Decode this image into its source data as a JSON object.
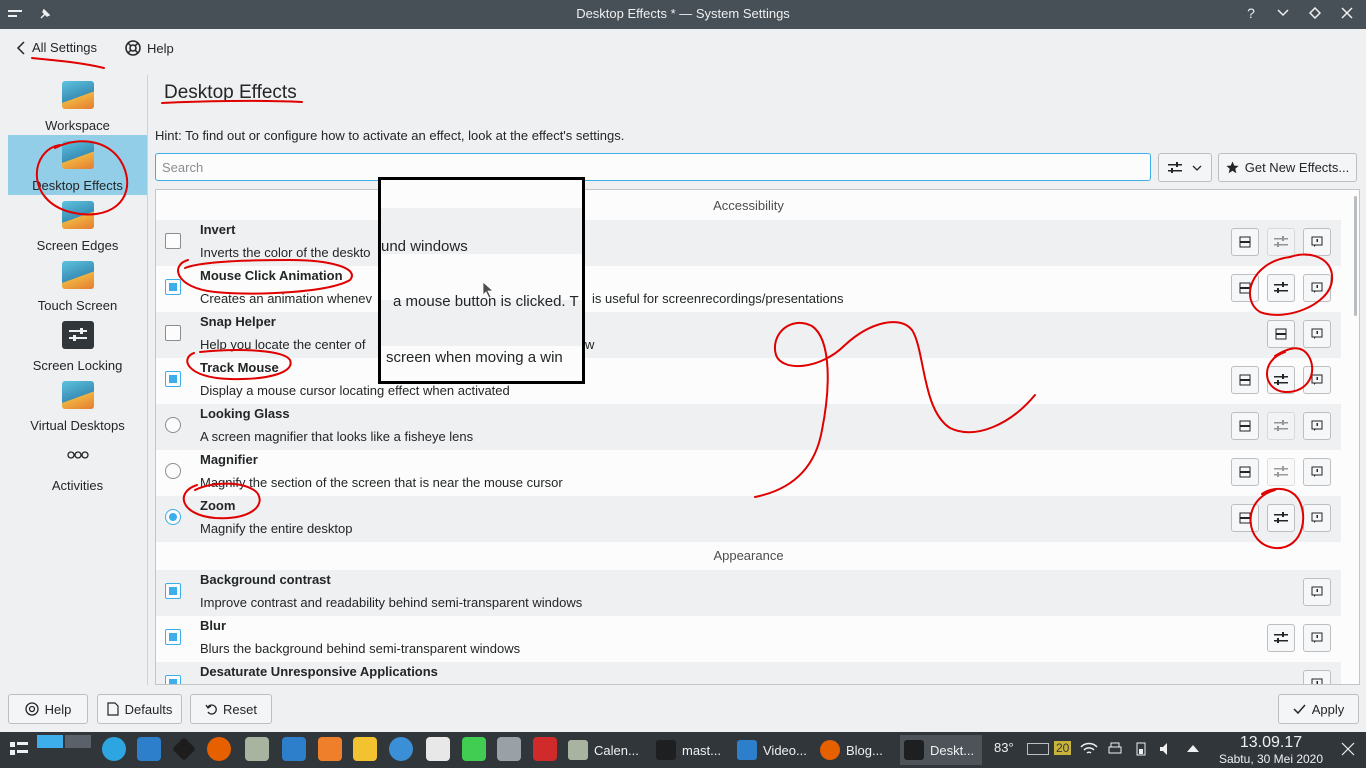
{
  "window": {
    "title": "Desktop Effects * — System Settings",
    "controls": [
      "?",
      "⌄",
      "◇",
      "✕"
    ]
  },
  "toolbar": {
    "back_label": "All Settings",
    "help_label": "Help"
  },
  "sidebar": {
    "items": [
      {
        "label": "Workspace"
      },
      {
        "label": "Desktop Effects"
      },
      {
        "label": "Screen Edges"
      },
      {
        "label": "Touch Screen"
      },
      {
        "label": "Screen Locking"
      },
      {
        "label": "Virtual Desktops"
      },
      {
        "label": "Activities"
      }
    ]
  },
  "main": {
    "title": "Desktop Effects",
    "hint": "Hint: To find out or configure how to activate an effect, look at the effect's settings.",
    "search_placeholder": "Search",
    "get_new_label": "Get New Effects...",
    "sections": [
      {
        "name": "Accessibility"
      },
      {
        "name": "Appearance"
      }
    ],
    "effects": [
      {
        "name": "Invert",
        "desc": "Inverts the color of the deskto",
        "state": "unchecked"
      },
      {
        "name": "Mouse Click Animation",
        "desc": "Creates an animation whenev",
        "desc2": "is useful for screenrecordings/presentations",
        "state": "checked"
      },
      {
        "name": "Snap Helper",
        "desc": "Help you locate the center of",
        "desc2": "w",
        "state": "unchecked"
      },
      {
        "name": "Track Mouse",
        "desc": "Display a mouse cursor locating effect when activated",
        "state": "checked"
      },
      {
        "name": "Looking Glass",
        "desc": "A screen magnifier that looks like a fisheye lens",
        "state": "radio"
      },
      {
        "name": "Magnifier",
        "desc": "Magnify the section of the screen that is near the mouse cursor",
        "state": "radio"
      },
      {
        "name": "Zoom",
        "desc": "Magnify the entire desktop",
        "state": "radio-checked"
      },
      {
        "name": "Background contrast",
        "desc": "Improve contrast and readability behind semi-transparent windows",
        "state": "checked"
      },
      {
        "name": "Blur",
        "desc": "Blurs the background behind semi-transparent windows",
        "state": "checked"
      },
      {
        "name": "Desaturate Unresponsive Applications",
        "desc": "",
        "state": "checked"
      }
    ],
    "overlay_lines": [
      "und windows",
      "a mouse button is clicked. T",
      "screen when moving a win"
    ]
  },
  "bottom": {
    "help_label": "Help",
    "defaults_label": "Defaults",
    "reset_label": "Reset",
    "apply_label": "Apply"
  },
  "taskbar": {
    "tasks": [
      {
        "label": "Calen..."
      },
      {
        "label": "mast..."
      },
      {
        "label": "Video..."
      },
      {
        "label": "Blog..."
      },
      {
        "label": "Deskt..."
      }
    ],
    "temperature": "83°",
    "badge": "20",
    "time": "13.09.17",
    "date": "Sabtu, 30 Mei 2020"
  },
  "colors": {
    "accent": "#3daee9",
    "annotation": "#e00000",
    "titlebar": "#475057",
    "taskbar": "#31363b"
  }
}
